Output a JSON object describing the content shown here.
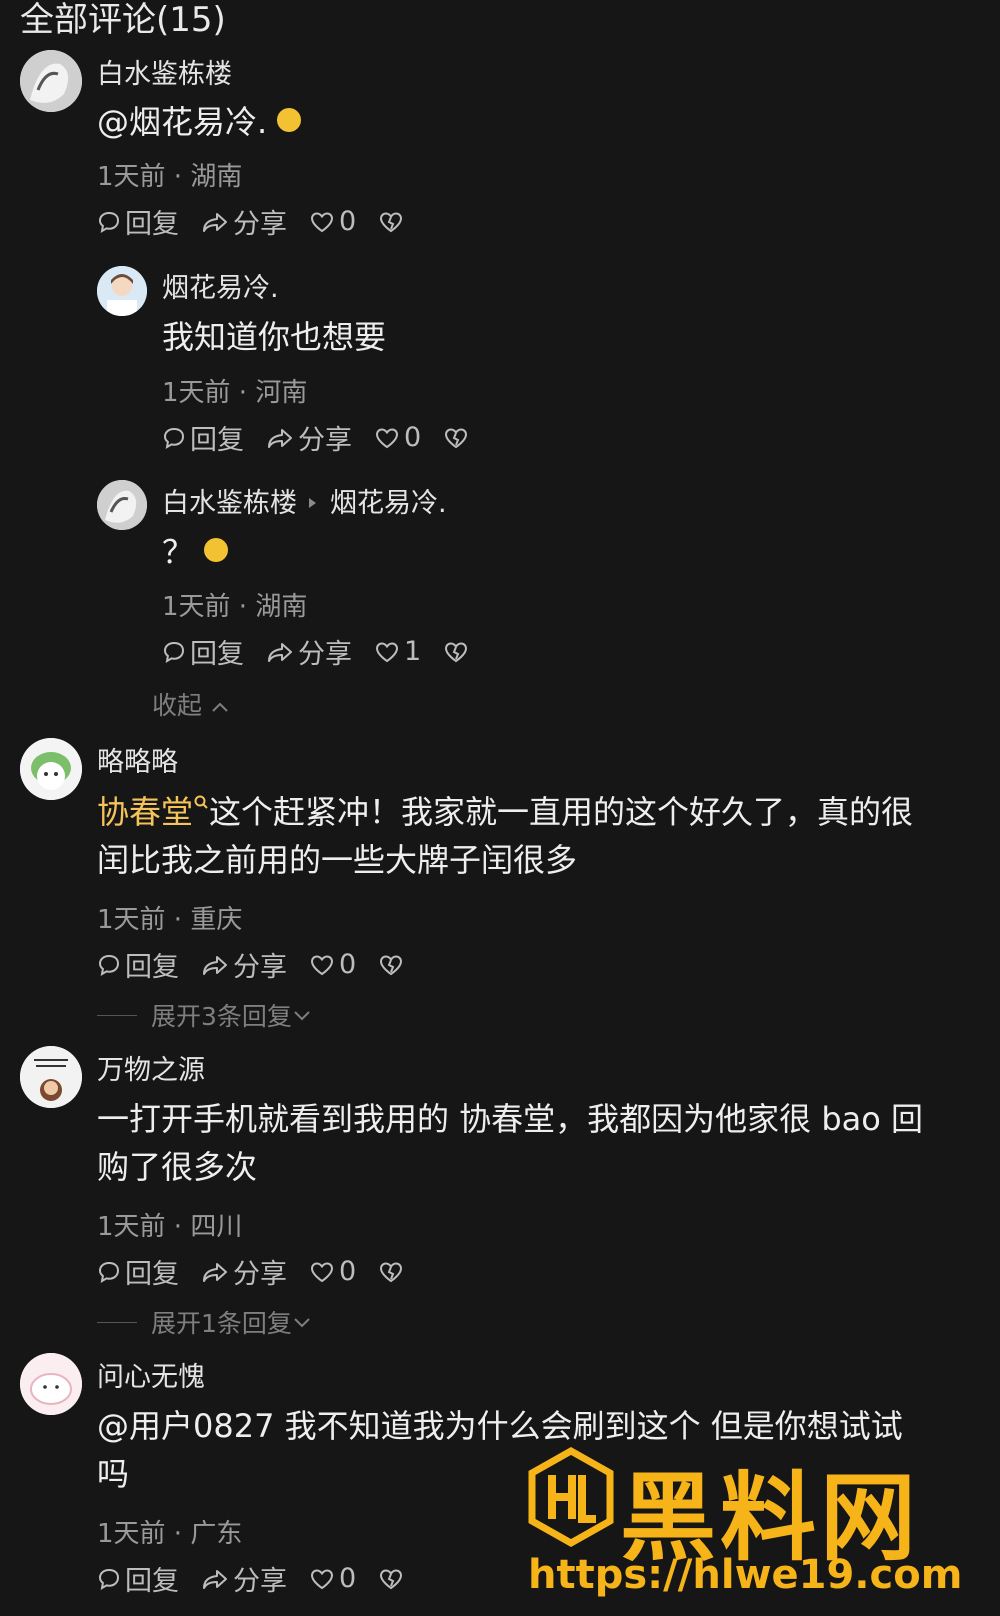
{
  "header": {
    "title": "全部评论(15)"
  },
  "actions": {
    "reply": "回复",
    "share": "分享"
  },
  "comments": [
    {
      "user": "白水鉴栋楼",
      "text": "@烟花易冷.",
      "meta": "1天前 · 湖南",
      "likes": "0",
      "replies": [
        {
          "user": "烟花易冷.",
          "text": "我知道你也想要",
          "meta": "1天前 · 河南",
          "likes": "0"
        },
        {
          "user": "白水鉴栋楼",
          "reply_to": "烟花易冷.",
          "text": "？",
          "meta": "1天前 · 湖南",
          "likes": "1"
        }
      ],
      "collapse_label": "收起"
    },
    {
      "user": "略略略",
      "link_text": "协春堂",
      "text_line1": "这个赶紧冲！我家就一直用的这个好久了，真的很",
      "text_line2": "闰比我之前用的一些大牌子闰很多",
      "meta": "1天前 · 重庆",
      "likes": "0",
      "expand_label": "展开3条回复"
    },
    {
      "user": "万物之源",
      "text_line1": "一打开手机就看到我用的 协春堂，我都因为他家很 bao 回",
      "text_line2": "购了很多次",
      "meta": "1天前 · 四川",
      "likes": "0",
      "expand_label": "展开1条回复"
    },
    {
      "user": "问心无愧",
      "text_line1": "@用户0827 我不知道我为什么会刷到这个 但是你想试试",
      "text_line2": "吗",
      "meta": "1天前 · 广东",
      "likes": "0"
    }
  ],
  "watermark": {
    "brand": "黑料网",
    "url": "https://hlwe19.com"
  },
  "colors": {
    "background": "#161616",
    "link": "#f4c35a",
    "watermark": "#f7b418"
  }
}
